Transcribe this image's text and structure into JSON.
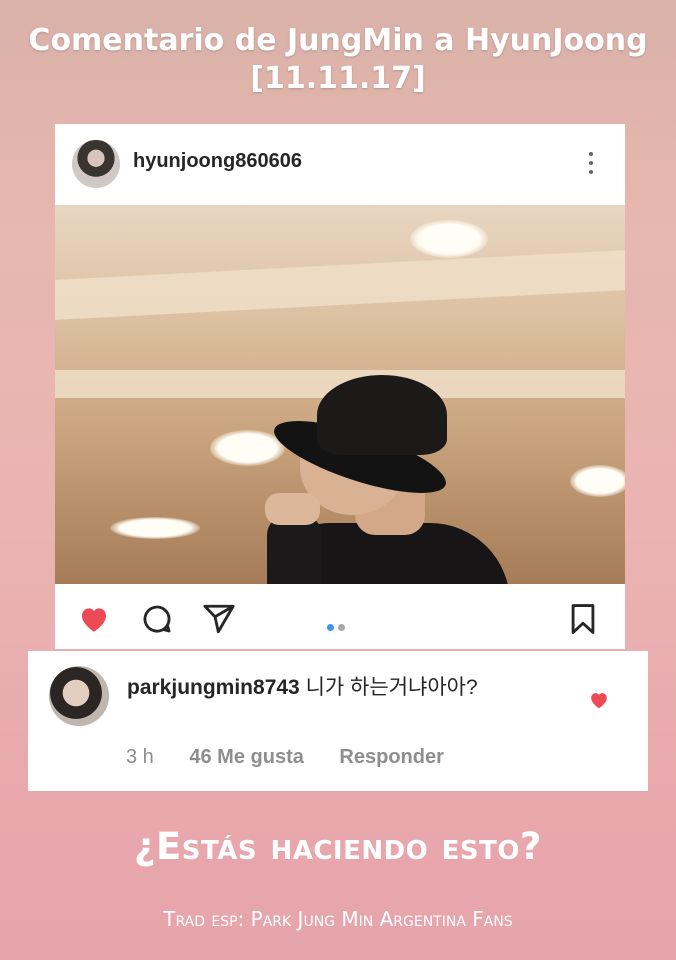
{
  "title_line1": "Comentario de JungMin a HyunJoong",
  "title_line2": "[11.11.17]",
  "post": {
    "username": "hyunjoong860606",
    "icons": [
      "avatar",
      "more-vertical-icon",
      "heart-icon",
      "comment-icon",
      "share-icon",
      "carousel-dots",
      "bookmark-icon"
    ],
    "liked": true,
    "colors": {
      "heart": "#ed4956",
      "active_dot": "#3897f0",
      "inactive_dot": "#a8a8a8"
    }
  },
  "comment": {
    "username": "parkjungmin8743",
    "text": "니가 하는거냐아아?",
    "time": "3 h",
    "likes": "46 Me gusta",
    "reply": "Responder"
  },
  "translation": "¿Estás haciendo esto?",
  "credit": "Trad esp: Park Jung Min Argentina Fans"
}
